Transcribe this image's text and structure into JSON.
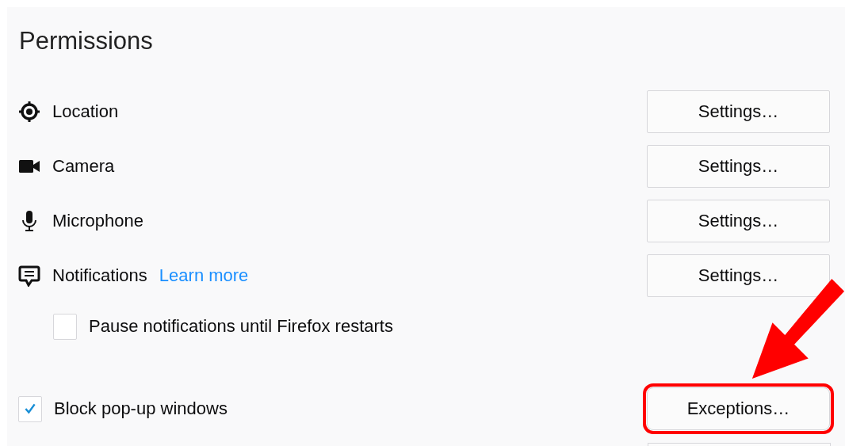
{
  "section": {
    "title": "Permissions"
  },
  "permissions": [
    {
      "kind": "location",
      "label": "Location",
      "button": "Settings…"
    },
    {
      "kind": "camera",
      "label": "Camera",
      "button": "Settings…"
    },
    {
      "kind": "microphone",
      "label": "Microphone",
      "button": "Settings…"
    },
    {
      "kind": "notifications",
      "label": "Notifications",
      "link": "Learn more",
      "button": "Settings…"
    }
  ],
  "pause_option": {
    "label": "Pause notifications until Firefox restarts",
    "checked": false
  },
  "popup_option": {
    "label": "Block pop-up windows",
    "checked": true,
    "button": "Exceptions…"
  }
}
